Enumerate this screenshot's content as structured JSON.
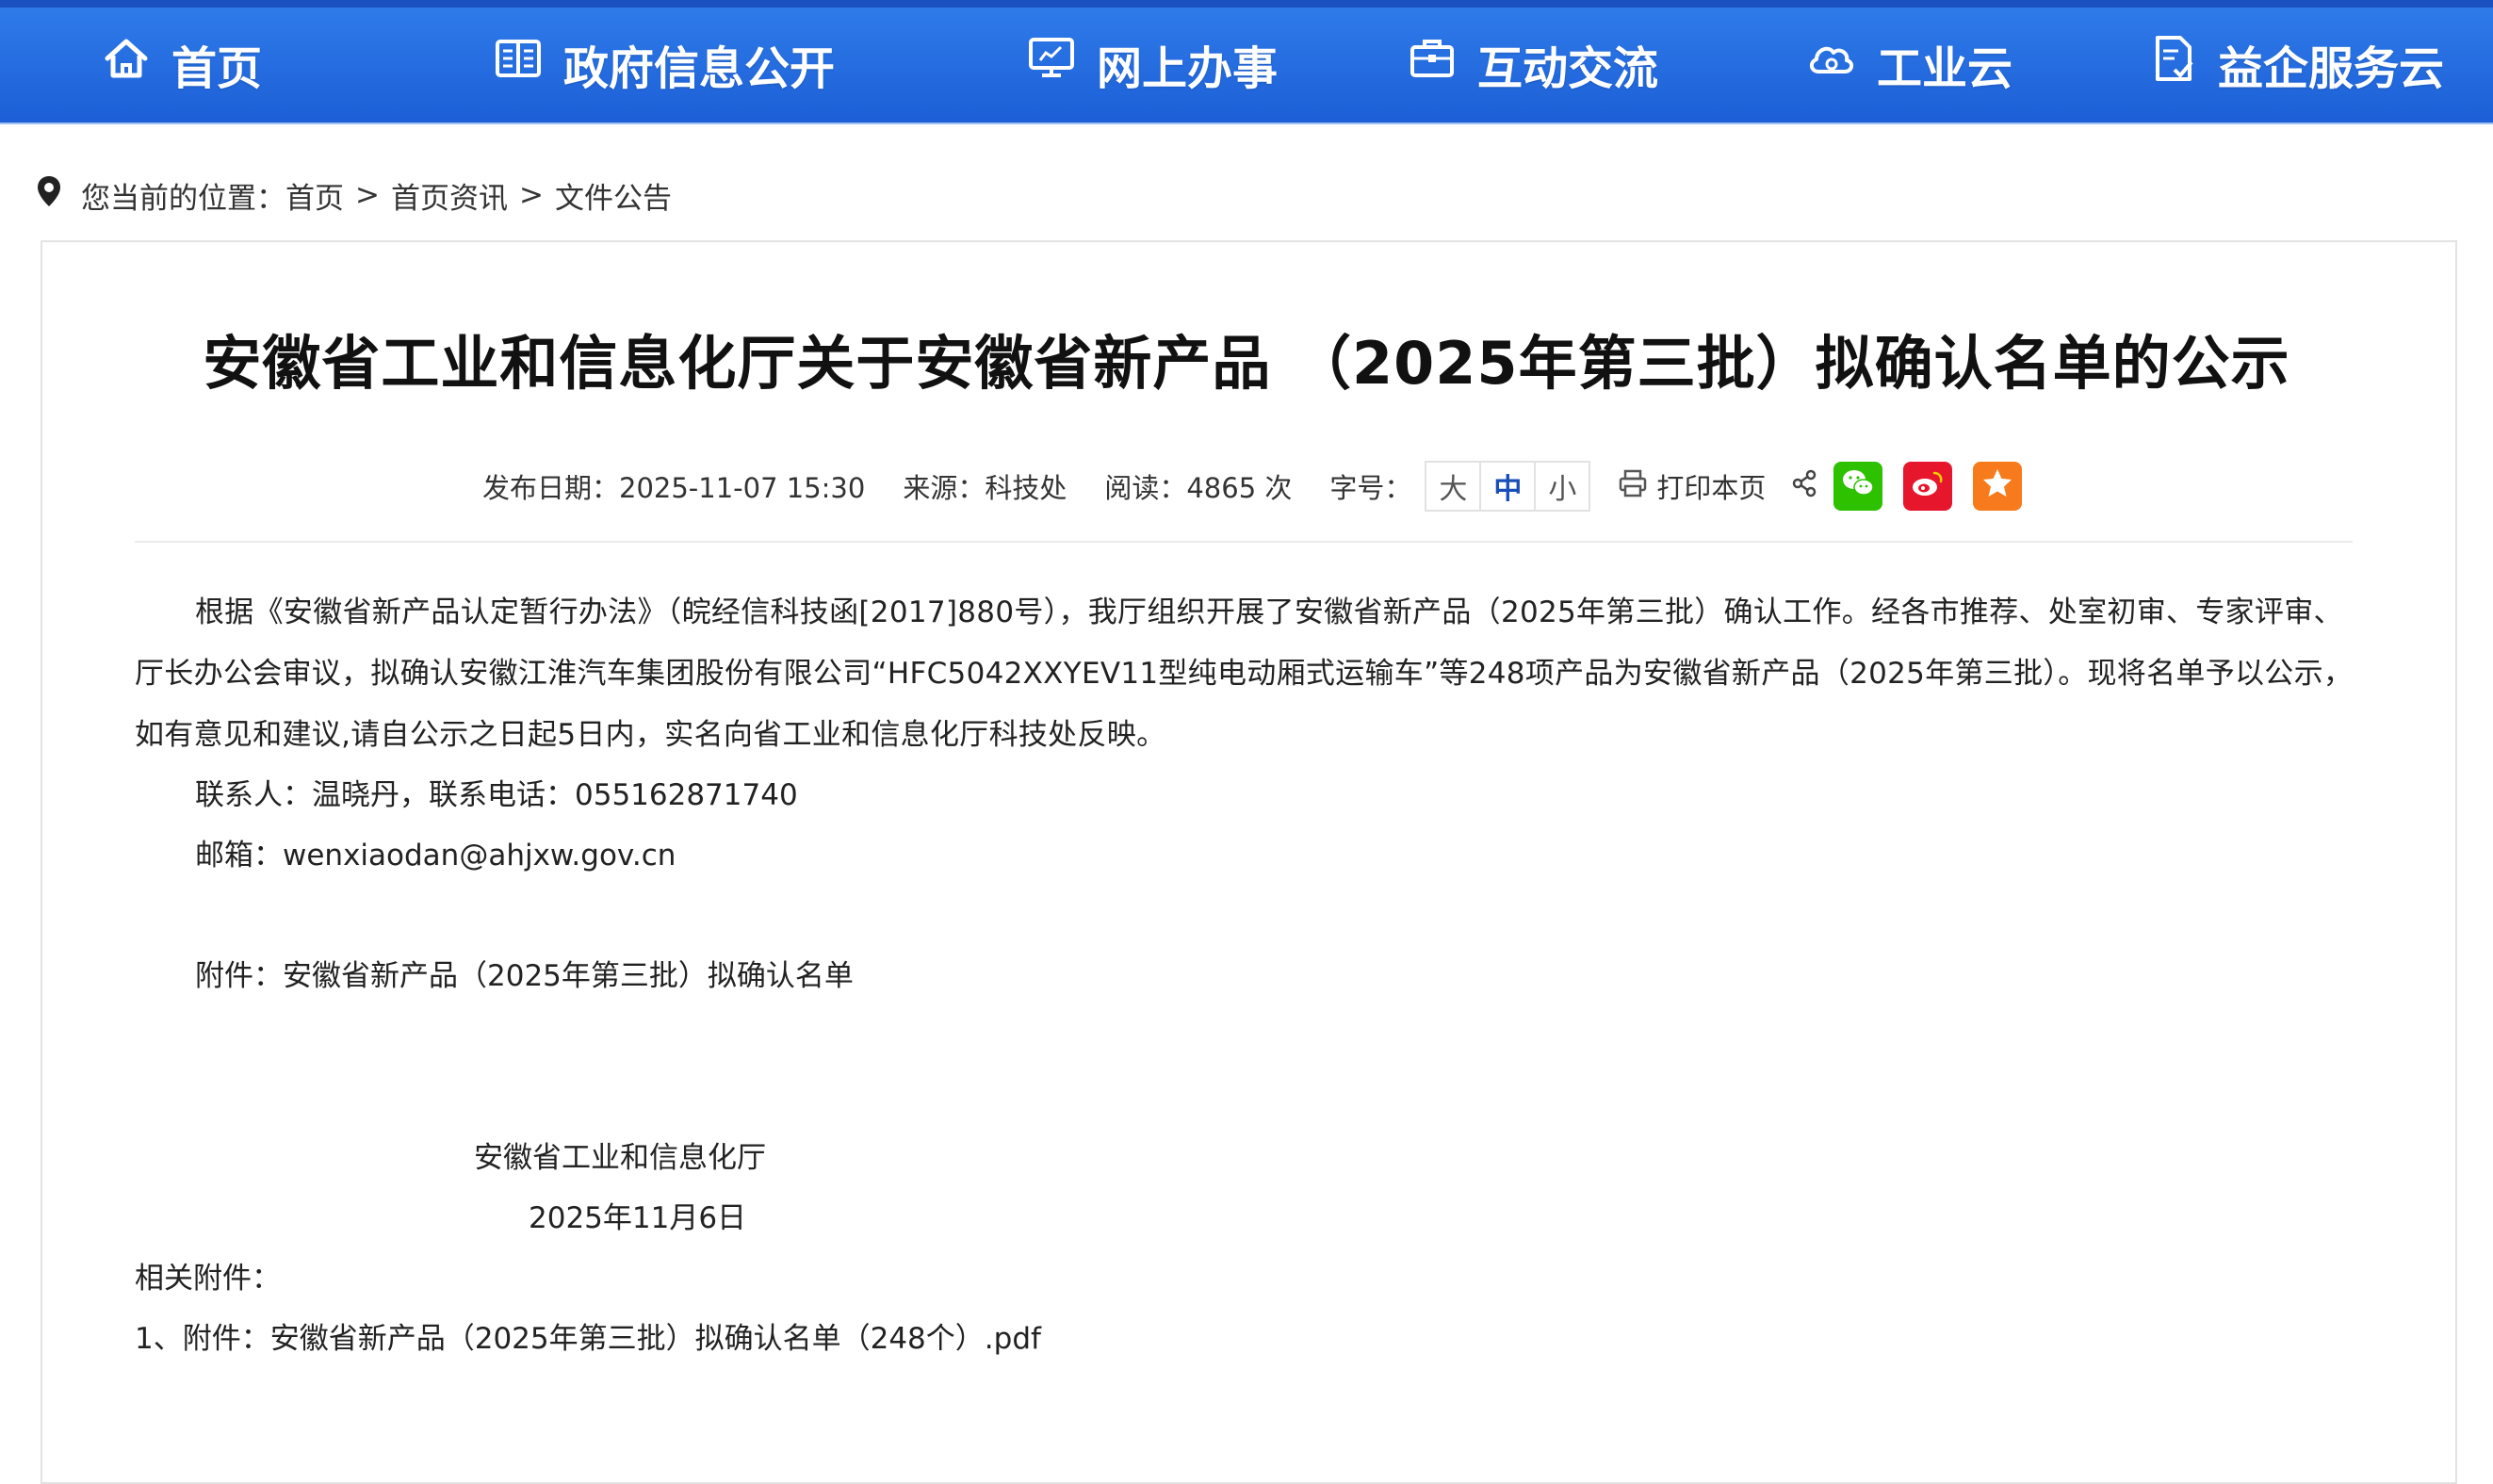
{
  "nav": {
    "items": [
      {
        "label": "首页",
        "icon": "home-icon"
      },
      {
        "label": "政府信息公开",
        "icon": "book-icon"
      },
      {
        "label": "网上办事",
        "icon": "monitor-icon"
      },
      {
        "label": "互动交流",
        "icon": "briefcase-icon"
      },
      {
        "label": "工业云",
        "icon": "cloud-icon"
      },
      {
        "label": "益企服务云",
        "icon": "document-icon"
      }
    ],
    "bg_color": "#2366dd"
  },
  "breadcrumb": {
    "prefix": "您当前的位置：",
    "items": [
      "首页",
      "首页资讯",
      "文件公告"
    ],
    "separator": ">"
  },
  "article": {
    "title": "安徽省工业和信息化厅关于安徽省新产品 （2025年第三批）拟确认名单的公示",
    "meta": {
      "publish": "发布日期：2025-11-07 15:30",
      "source": "来源：科技处",
      "views": "阅读：4865 次",
      "font_label": "字号：",
      "font_sizes": [
        "大",
        "中",
        "小"
      ],
      "print_label": "打印本页"
    },
    "body": "根据《安徽省新产品认定暂行办法》（皖经信科技函[2017]880号），我厅组织开展了安徽省新产品（2025年第三批）确认工作。经各市推荐、处室初审、专家评审、厅长办公会审议，拟确认安徽江淮汽车集团股份有限公司“HFC5042XXYEV11型纯电动厢式运输车”等248项产品为安徽省新产品（2025年第三批）。现将名单予以公示，如有意见和建议,请自公示之日起5日内，实名向省工业和信息化厅科技处反映。",
    "contact": "联系人：温晓丹，联系电话：055162871740",
    "email": "邮箱：wenxiaodan@ahjxw.gov.cn",
    "attachment": "附件：安徽省新产品（2025年第三批）拟确认名单",
    "org": "安徽省工业和信息化厅",
    "date": "2025年11月6日",
    "related_label": "相关附件：",
    "files": [
      "1、附件：安徽省新产品（2025年第三批）拟确认名单（248个）.pdf"
    ]
  },
  "colors": {
    "wechat": "#2dc100",
    "weibo": "#e6162d",
    "favorite": "#f77b1c",
    "active_font": "#1a4fb8"
  }
}
